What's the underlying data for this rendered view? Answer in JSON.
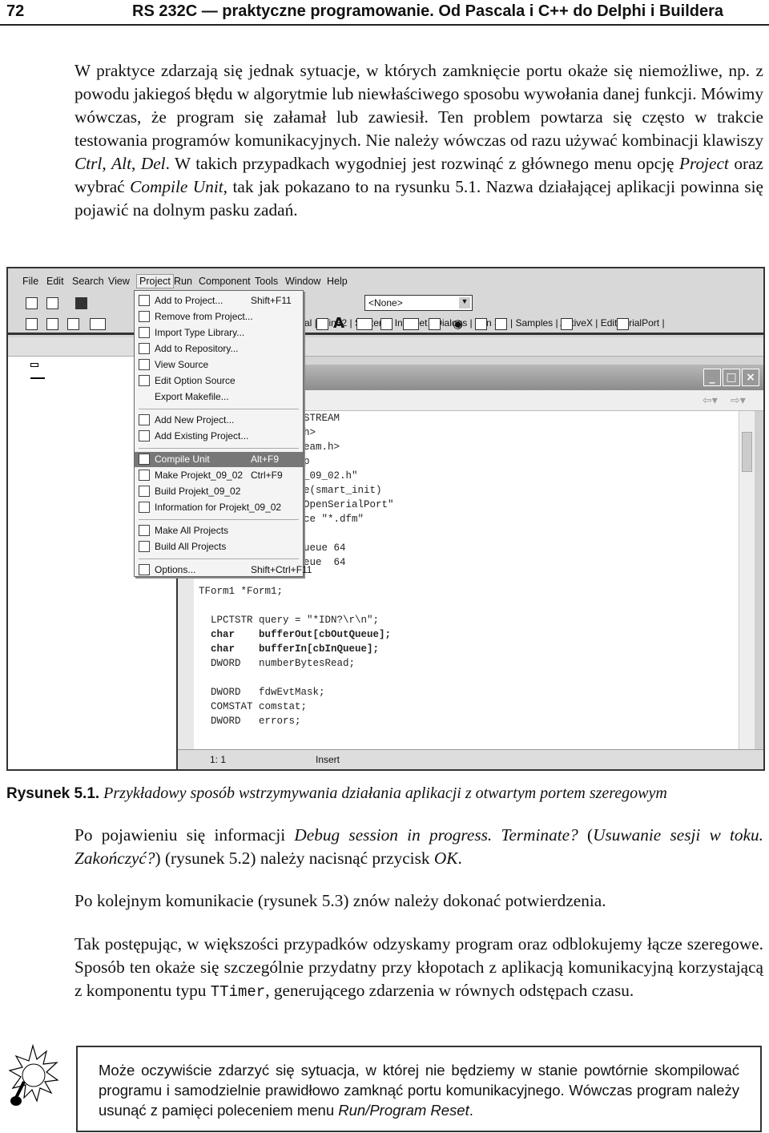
{
  "header": {
    "page_number": "72",
    "running_title": "RS 232C — praktyczne programowanie. Od Pascala i C++ do Delphi i Buildera"
  },
  "paragraphs": [
    {
      "segments": [
        {
          "t": "W praktyce zdarzają się jednak sytuacje, w których zamknięcie portu okaże się niemożliwe, np. z powodu jakiegoś błędu w algorytmie lub niewłaściwego sposobu wywołania danej funkcji. Mówimy wówczas, że program się załamał lub zawiesił. Ten problem powtarza się często w trakcie testowania programów komunikacyjnych. Nie należy wówczas od razu używać kombinacji klawiszy "
        },
        {
          "t": "Ctrl",
          "s": "i"
        },
        {
          "t": ", "
        },
        {
          "t": "Alt",
          "s": "i"
        },
        {
          "t": ", "
        },
        {
          "t": "Del",
          "s": "i"
        },
        {
          "t": ". W takich przypadkach wygodniej jest rozwinąć z głównego menu opcję "
        },
        {
          "t": "Project",
          "s": "i"
        },
        {
          "t": " oraz wybrać "
        },
        {
          "t": "Compile Unit",
          "s": "i"
        },
        {
          "t": ", tak jak pokazano to na rysunku 5.1. Nazwa działającej aplikacji powinna się pojawić na dolnym pasku zadań."
        }
      ]
    },
    {
      "segments": [
        {
          "t": "Po pojawieniu się informacji "
        },
        {
          "t": "Debug session in progress. Terminate?",
          "s": "i"
        },
        {
          "t": " ("
        },
        {
          "t": "Usuwanie sesji w toku. Zakończyć?",
          "s": "i"
        },
        {
          "t": ") (rysunek 5.2) należy nacisnąć przycisk "
        },
        {
          "t": "OK",
          "s": "i"
        },
        {
          "t": "."
        }
      ]
    },
    {
      "segments": [
        {
          "t": "Po kolejnym komunikacie (rysunek 5.3) znów należy dokonać potwierdzenia."
        }
      ]
    },
    {
      "segments": [
        {
          "t": "Tak postępując, w większości przypadków odzyskamy program oraz odblokujemy łącze szeregowe. Sposób ten okaże się szczególnie przydatny przy kłopotach z aplikacją komunikacyjną korzystającą z komponentu typu "
        },
        {
          "t": "TTimer",
          "s": "mono"
        },
        {
          "t": ", generującego zdarzenia w równych odstępach czasu."
        }
      ]
    }
  ],
  "figure": {
    "menubar": [
      "File",
      "Edit",
      "Search",
      "View",
      "Project",
      "Run",
      "Component",
      "Tools",
      "Window",
      "Help"
    ],
    "combo_value": "<None>",
    "palette_tabs": "al | Win32 | System | Internet | Dialogs | Win 3.1 | Samples | ActiveX | EditSerialPort |",
    "project_menu": [
      {
        "label": "Add to Project...",
        "shortcut": "Shift+F11"
      },
      {
        "label": "Remove from Project..."
      },
      {
        "label": "Import Type Library..."
      },
      {
        "label": "Add to Repository..."
      },
      {
        "label": "View Source"
      },
      {
        "label": "Edit Option Source"
      },
      {
        "label": "Export Makefile...",
        "noicon": true
      },
      {
        "sep": true
      },
      {
        "label": "Add New Project..."
      },
      {
        "label": "Add Existing Project..."
      },
      {
        "sep": true
      },
      {
        "label": "Compile Unit",
        "shortcut": "Alt+F9",
        "highlighted": true
      },
      {
        "label": "Make Projekt_09_02",
        "shortcut": "Ctrl+F9"
      },
      {
        "label": "Build Projekt_09_02"
      },
      {
        "label": "Information for Projekt_09_02"
      },
      {
        "sep": true
      },
      {
        "label": "Make All Projects"
      },
      {
        "label": "Build All Projects"
      },
      {
        "sep": true
      },
      {
        "label": "Options...",
        "shortcut": "Shift+Ctrl+F11"
      }
    ],
    "code_fragments": [
      "STREAM",
      "h>",
      "eam.h>",
      "p",
      "_09_02.h\"",
      "e(smart_init)",
      "OpenSerialPort\"",
      "ce \"*.dfm\"",
      "",
      "ueue 64",
      "eue  64"
    ],
    "code_lines": [
      "TForm1 *Form1;",
      "",
      "  LPCTSTR query = \"*IDN?\\r\\n\";",
      "  char    bufferOut[cbOutQueue];",
      "  char    bufferIn[cbInQueue];",
      "  DWORD   numberBytesRead;",
      "",
      "  DWORD   fdwEvtMask;",
      "  COMSTAT comstat;",
      "  DWORD   errors;"
    ],
    "status": {
      "position": "1:  1",
      "mode": "Insert"
    }
  },
  "caption": {
    "label": "Rysunek 5.1.",
    "text": " Przykładowy sposób wstrzymywania działania aplikacji z otwartym portem szeregowym"
  },
  "note": {
    "segments": [
      {
        "t": "Może oczywiście zdarzyć się sytuacja, w której nie będziemy w stanie powtórnie skompilować programu i samodzielnie prawidłowo zamknąć portu komunikacyjnego. Wówczas program należy usunąć z pamięci poleceniem menu "
      },
      {
        "t": "Run/Program Reset",
        "s": "i"
      },
      {
        "t": "."
      }
    ]
  }
}
